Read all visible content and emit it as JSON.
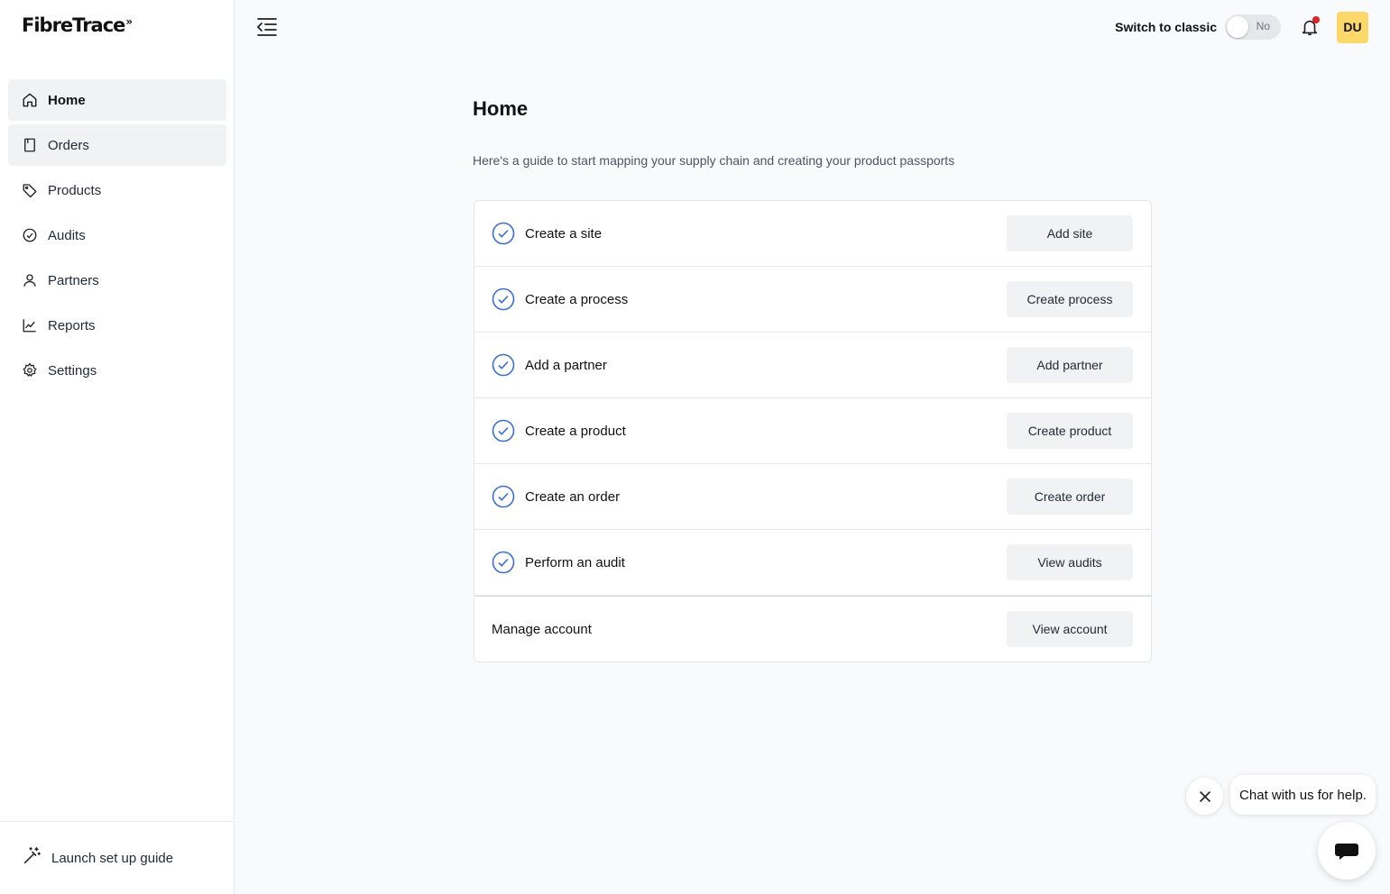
{
  "brand": {
    "name": "FibreTrace",
    "mark": "»"
  },
  "sidebar": {
    "items": [
      {
        "label": "Home",
        "icon": "home-icon"
      },
      {
        "label": "Orders",
        "icon": "orders-icon"
      },
      {
        "label": "Products",
        "icon": "tag-icon"
      },
      {
        "label": "Audits",
        "icon": "check-circle-icon"
      },
      {
        "label": "Partners",
        "icon": "user-icon"
      },
      {
        "label": "Reports",
        "icon": "chart-line-icon"
      },
      {
        "label": "Settings",
        "icon": "gear-icon"
      }
    ],
    "footer_label": "Launch set up guide"
  },
  "topbar": {
    "switch_label": "Switch to classic",
    "toggle_value": "No",
    "avatar_initials": "DU"
  },
  "main": {
    "title": "Home",
    "subtitle": "Here's a guide to start mapping your supply chain and creating your product passports",
    "steps": [
      {
        "label": "Create a site",
        "button": "Add site"
      },
      {
        "label": "Create a process",
        "button": "Create process"
      },
      {
        "label": "Add a partner",
        "button": "Add partner"
      },
      {
        "label": "Create a product",
        "button": "Create product"
      },
      {
        "label": "Create an order",
        "button": "Create order"
      },
      {
        "label": "Perform an audit",
        "button": "View audits"
      }
    ],
    "account": {
      "label": "Manage account",
      "button": "View account"
    }
  },
  "chat": {
    "prompt": "Chat with us for help."
  },
  "colors": {
    "accent_check": "#3b6fd1",
    "avatar_bg": "#fcd86a",
    "notification_dot": "#dc2626",
    "button_bg": "#f1f2f4"
  }
}
